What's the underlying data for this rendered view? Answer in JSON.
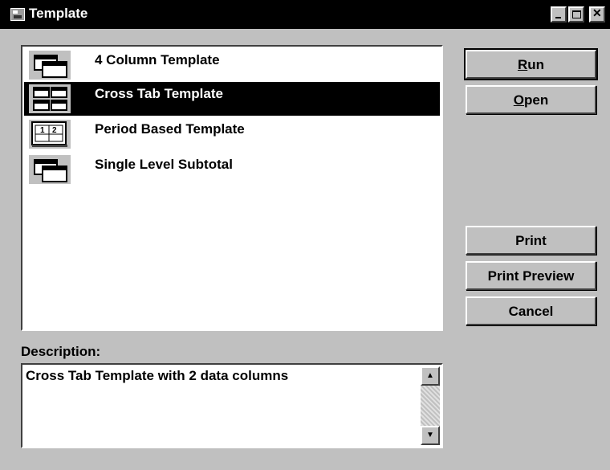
{
  "window": {
    "title": "Template"
  },
  "list": {
    "items": [
      {
        "label": "4 Column Template",
        "icon": "stacked-windows-icon",
        "selected": false
      },
      {
        "label": "Cross Tab Template",
        "icon": "grid-four-icon",
        "selected": true
      },
      {
        "label": "Period Based Template",
        "icon": "period-12-icon",
        "selected": false
      },
      {
        "label": "Single Level Subtotal",
        "icon": "stacked-windows-icon",
        "selected": false
      }
    ]
  },
  "buttons": {
    "run": {
      "mnemonic": "R",
      "rest": "un"
    },
    "open": {
      "mnemonic": "O",
      "rest": "pen"
    },
    "print": "Print",
    "print_preview": "Print Preview",
    "cancel": "Cancel"
  },
  "description": {
    "label": "Description:",
    "text": "Cross Tab Template with 2 data columns"
  },
  "icons": {
    "scroll_up": "▲",
    "scroll_down": "▼"
  }
}
